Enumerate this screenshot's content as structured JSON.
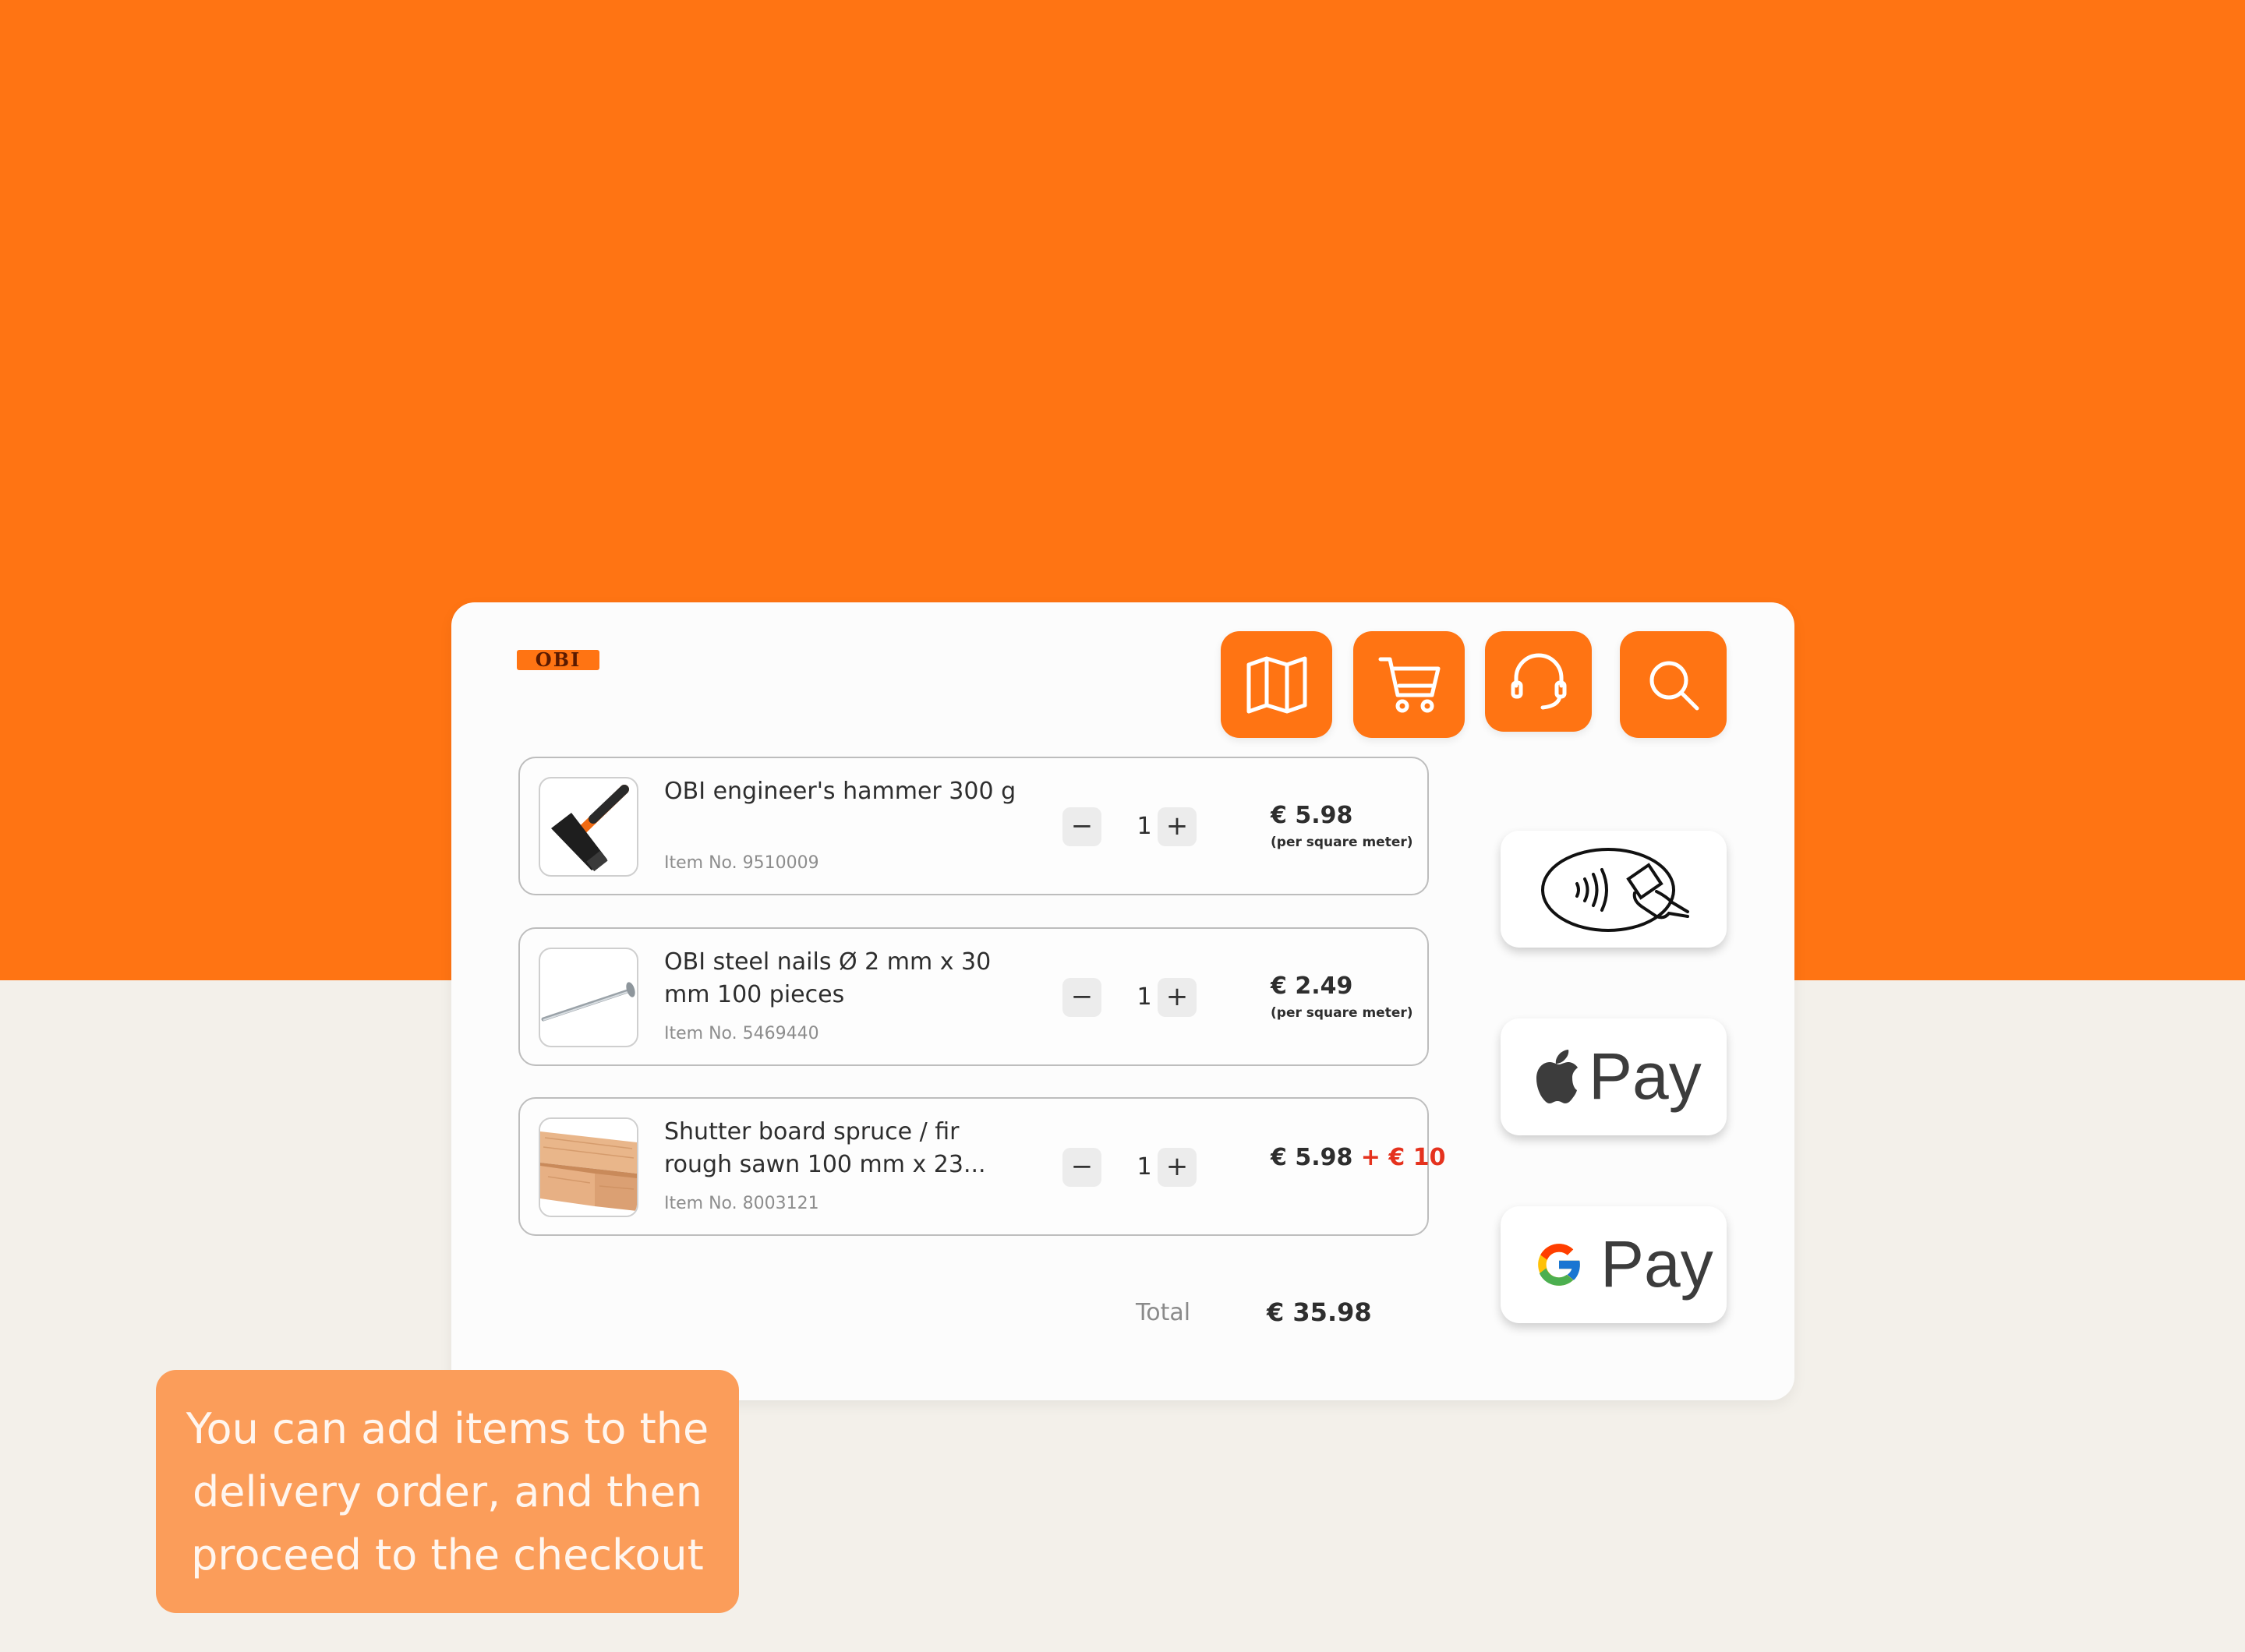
{
  "brand": {
    "logo_text": "OBI",
    "accent_color": "#ff7413",
    "background_color": "#f3f0ea"
  },
  "toolbar": {
    "buttons": [
      {
        "icon": "map-icon"
      },
      {
        "icon": "cart-icon"
      },
      {
        "icon": "headset-icon"
      },
      {
        "icon": "search-icon"
      }
    ]
  },
  "cart": {
    "items": [
      {
        "name": "OBI engineer's hammer 300 g",
        "item_no": "Item No. 9510009",
        "qty": "1",
        "price": "€ 5.98",
        "price_extra": "",
        "price_unit": "(per square meter)",
        "image": "hammer"
      },
      {
        "name": "OBI steel nails Ø 2 mm x 30 mm 100 pieces",
        "item_no": "Item No. 5469440",
        "qty": "1",
        "price": "€ 2.49",
        "price_extra": "",
        "price_unit": "(per square meter)",
        "image": "nail"
      },
      {
        "name": "Shutter board spruce / fir rough sawn 100 mm x 23...",
        "item_no": "Item No. 8003121",
        "qty": "1",
        "price": "€ 5.98",
        "price_extra": "+ € 10",
        "price_unit": "",
        "image": "wood-boards"
      }
    ],
    "stepper": {
      "minus": "−",
      "plus": "+"
    },
    "total_label": "Total",
    "total_value": "€ 35.98"
  },
  "payment_methods": {
    "contactless": {
      "icon": "contactless-payment-icon"
    },
    "apple_pay": {
      "label": "Pay",
      "icon": "apple-icon"
    },
    "google_pay": {
      "label": "Pay",
      "icon": "google-g-icon"
    }
  },
  "caption": {
    "text": "You can add items to the delivery order, and then proceed to the checkout"
  }
}
